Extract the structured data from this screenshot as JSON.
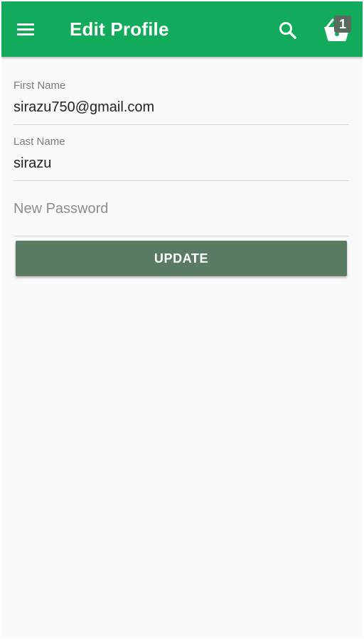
{
  "app_bar": {
    "title": "Edit Profile",
    "background_color": "#12ab5c",
    "menu_icon": "menu-icon",
    "search_icon": "search-icon",
    "cart_icon": "shopping-basket-icon",
    "cart_count": "1"
  },
  "form": {
    "first_name": {
      "label": "First Name",
      "value": "sirazu750@gmail.com"
    },
    "last_name": {
      "label": "Last Name",
      "value": "sirazu"
    },
    "new_password": {
      "placeholder": "New Password",
      "value": ""
    },
    "update_label": "UPDATE",
    "update_color": "#587b62"
  }
}
